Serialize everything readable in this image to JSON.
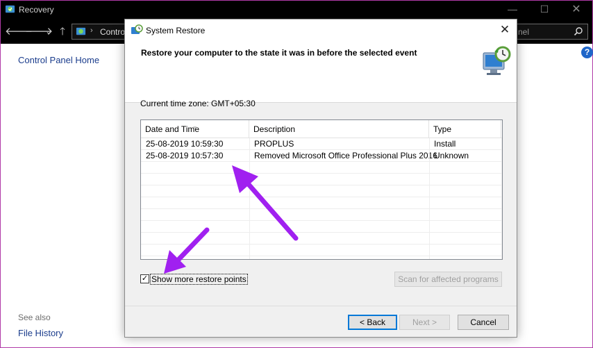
{
  "background_window": {
    "title": "Recovery",
    "address": "Control",
    "search_placeholder": "nel",
    "sidebar_home": "Control Panel Home",
    "see_also": "See also",
    "file_history": "File History",
    "help": "?"
  },
  "dialog": {
    "title": "System Restore",
    "heading": "Restore your computer to the state it was in before the selected event",
    "timezone": "Current time zone: GMT+05:30",
    "columns": {
      "date": "Date and Time",
      "description": "Description",
      "type": "Type"
    },
    "rows": [
      {
        "date": "25-08-2019 10:59:30",
        "description": "PROPLUS",
        "type": "Install"
      },
      {
        "date": "25-08-2019 10:57:30",
        "description": "Removed Microsoft Office Professional Plus 2016",
        "type": "Unknown"
      }
    ],
    "show_more_label": "Show more restore points",
    "show_more_checked": "✓",
    "scan_button": "Scan for affected programs",
    "back_button": "< Back",
    "next_button": "Next >",
    "cancel_button": "Cancel"
  },
  "colors": {
    "annotation_arrow": "#a020f0",
    "accent": "#0078d7",
    "window_border": "#b03aa8"
  }
}
